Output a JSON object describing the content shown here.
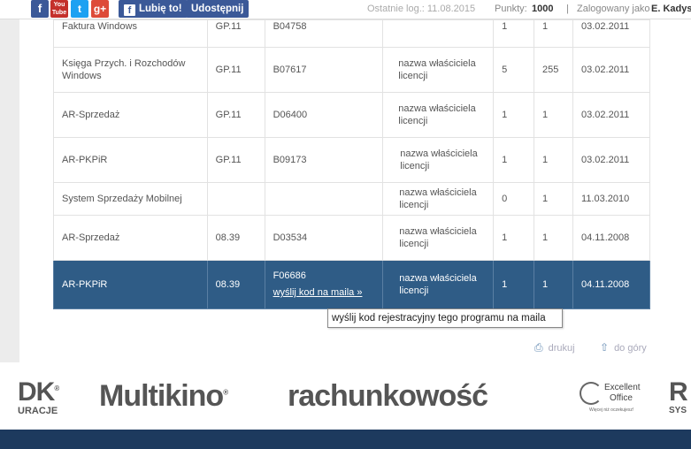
{
  "topbar": {
    "icons": [
      {
        "name": "facebook-icon",
        "glyph": "f",
        "color": "#3b5998"
      },
      {
        "name": "youtube-icon",
        "glyph": "You Tube",
        "color": "#c4302b"
      },
      {
        "name": "twitter-icon",
        "glyph": "t",
        "color": "#1da1f2"
      },
      {
        "name": "google-plus-icon",
        "glyph": "g+",
        "color": "#dd4b39"
      }
    ],
    "like_label": "Lubię to!",
    "share_label": "Udostępnij",
    "last_login": "Ostatnie log.: 11.08.2015",
    "points_label": "Punkty:",
    "points_value": "1000",
    "separator": "|",
    "logged_label": "Zalogowany jako",
    "user_name": "E. Kadys"
  },
  "rows": [
    {
      "program": "Faktura Windows",
      "version": "GP.11",
      "code": "B04758",
      "owner": "",
      "a": "1",
      "b": "1",
      "date": "03.02.2011"
    },
    {
      "program": "Księga Przych. i Rozchodów Windows",
      "version": "GP.11",
      "code": "B07617",
      "owner": "nazwa właściciela licencji",
      "a": "5",
      "b": "255",
      "date": "03.02.2011"
    },
    {
      "program": "AR-Sprzedaż",
      "version": "GP.11",
      "code": "D06400",
      "owner": "nazwa właściciela licencji",
      "a": "1",
      "b": "1",
      "date": "03.02.2011"
    },
    {
      "program": "AR-PKPiR",
      "version": "GP.11",
      "code": "B09173",
      "owner": "nazwa właściciela licencji",
      "a": "1",
      "b": "1",
      "date": "03.02.2011"
    },
    {
      "program": "System Sprzedaży Mobilnej",
      "version": "",
      "code": "",
      "owner": "nazwa właściciela licencji",
      "a": "0",
      "b": "1",
      "date": "11.03.2010"
    },
    {
      "program": "AR-Sprzedaż",
      "version": "08.39",
      "code": "D03534",
      "owner": "nazwa właściciela licencji",
      "a": "1",
      "b": "1",
      "date": "04.11.2008"
    },
    {
      "program": "AR-PKPiR",
      "version": "08.39",
      "code": "F06686",
      "code_link": "wyślij kod na maila »",
      "owner": "nazwa właściciela licencji",
      "a": "1",
      "b": "1",
      "date": "04.11.2008"
    }
  ],
  "tooltip": "wyślij kod rejestracyjny tego programu na maila",
  "footer": {
    "print_label": "drukuj",
    "top_label": "do góry"
  },
  "logos": {
    "logo1_main": "DK",
    "logo1_sub": "URACJE",
    "multikino": "Multikino",
    "rachunkowosc": "rachunkowość",
    "excellent_line1": "Excellent",
    "excellent_line2": "Office",
    "excellent_tag": "Więcej niż oczekujesz!",
    "last_main": "R",
    "last_sub": "SYS"
  },
  "colors": {
    "selected_row": "#2f5c86",
    "footer_band": "#1d3a5e",
    "facebook": "#3b5998"
  }
}
